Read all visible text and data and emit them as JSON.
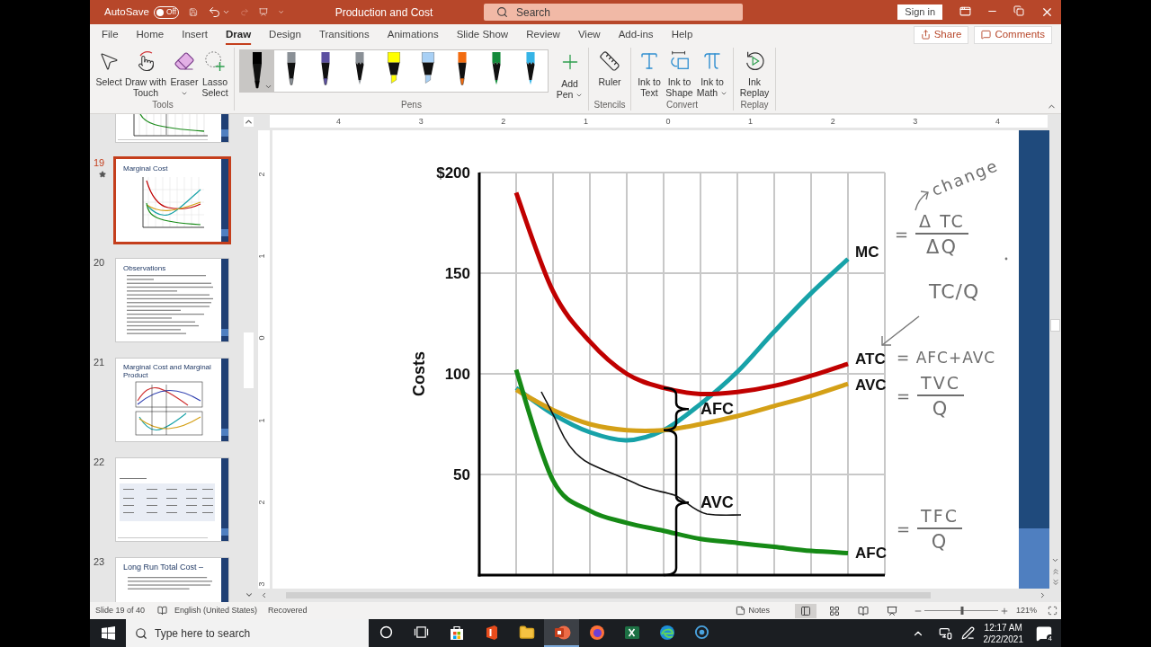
{
  "title_bar": {
    "autosave": {
      "label": "AutoSave",
      "state": "Off",
      "on": false
    },
    "quick_access": [
      {
        "kind": "save",
        "disabled": false
      },
      {
        "kind": "undo",
        "disabled": false
      },
      {
        "kind": "redo",
        "disabled": true
      },
      {
        "kind": "present",
        "disabled": false
      }
    ],
    "title": "Production and Cost",
    "search": {
      "placeholder": "Search"
    },
    "sign_in": "Sign in"
  },
  "tabs": [
    {
      "label": "File",
      "selected": false
    },
    {
      "label": "Home",
      "selected": false
    },
    {
      "label": "Insert",
      "selected": false
    },
    {
      "label": "Draw",
      "selected": true
    },
    {
      "label": "Design",
      "selected": false
    },
    {
      "label": "Transitions",
      "selected": false
    },
    {
      "label": "Animations",
      "selected": false
    },
    {
      "label": "Slide Show",
      "selected": false
    },
    {
      "label": "Review",
      "selected": false
    },
    {
      "label": "View",
      "selected": false
    },
    {
      "label": "Add-ins",
      "selected": false
    },
    {
      "label": "Help",
      "selected": false
    }
  ],
  "actions": [
    {
      "kind": "share",
      "label": "Share"
    },
    {
      "kind": "comments",
      "label": "Comments"
    }
  ],
  "ribbon": {
    "groups": [
      {
        "kind": "buttons",
        "label": "Tools",
        "items": [
          {
            "kind": "select",
            "label": "Select",
            "dropdown": false
          },
          {
            "kind": "touch",
            "label": "Draw with Touch",
            "dropdown": false
          },
          {
            "kind": "eraser",
            "label": "Eraser",
            "dropdown": true
          },
          {
            "kind": "lasso",
            "label": "Lasso Select",
            "dropdown": false
          }
        ]
      },
      {
        "kind": "gallery",
        "label": "Pens",
        "pens": [
          {
            "kind": "pen",
            "color": "#000000",
            "selected": true
          },
          {
            "kind": "pen",
            "color": "#8a9096",
            "selected": false
          },
          {
            "kind": "pen",
            "color": "#5b4fa0",
            "selected": false
          },
          {
            "kind": "pencil",
            "color": "#8a9096",
            "selected": false
          },
          {
            "kind": "highlighter",
            "color": "#ffff00",
            "selected": false
          },
          {
            "kind": "highlighter",
            "color": "#a8d0f5",
            "selected": false
          },
          {
            "kind": "pen",
            "color": "#f26b0f",
            "selected": false
          },
          {
            "kind": "pencil",
            "color": "#138a3a",
            "selected": false
          },
          {
            "kind": "pencil",
            "color": "#36b4e6",
            "selected": false
          }
        ],
        "items": [
          {
            "kind": "add-pen",
            "label": "Add Pen",
            "dropdown": true
          }
        ]
      },
      {
        "kind": "buttons",
        "label": "Stencils",
        "items": [
          {
            "kind": "ruler",
            "label": "Ruler",
            "dropdown": false
          }
        ]
      },
      {
        "kind": "buttons",
        "label": "Convert",
        "items": [
          {
            "kind": "ink-to-text",
            "label": "Ink to Text",
            "dropdown": false
          },
          {
            "kind": "ink-to-shape",
            "label": "Ink to Shape",
            "dropdown": false
          },
          {
            "kind": "ink-to-math",
            "label": "Ink to Math",
            "dropdown": true
          }
        ]
      },
      {
        "kind": "buttons",
        "label": "Replay",
        "items": [
          {
            "kind": "replay",
            "label": "Ink Replay",
            "dropdown": false
          }
        ]
      }
    ]
  },
  "slides_panel": {
    "thumbnails": [
      {
        "kind": "chart-bottom",
        "selected": false,
        "animated": false
      },
      {
        "number": "19",
        "title": "Marginal Cost",
        "kind": "chart",
        "selected": true,
        "animated": true
      },
      {
        "number": "20",
        "title": "Observations",
        "kind": "bullets",
        "selected": false,
        "animated": false
      },
      {
        "number": "21",
        "title": "Marginal Cost and Marginal Product",
        "kind": "two-charts",
        "selected": false,
        "animated": false
      },
      {
        "number": "22",
        "kind": "table",
        "selected": false,
        "animated": false
      },
      {
        "number": "23",
        "title": "Long Run Total Cost –",
        "kind": "text",
        "selected": false,
        "animated": false
      }
    ]
  },
  "rulers": {
    "horizontal": [
      "4",
      "3",
      "2",
      "1",
      "0",
      "1",
      "2",
      "3",
      "4"
    ],
    "vertical": [
      "2",
      "1",
      "0",
      "1",
      "2",
      "3"
    ]
  },
  "slide": {
    "chart_data": {
      "type": "line",
      "ylabel": "Costs",
      "categories": [
        null,
        null,
        null,
        null,
        null,
        null,
        null,
        null,
        null,
        null
      ],
      "ylim": [
        0,
        200
      ],
      "yticks": [
        {
          "value": 50,
          "label": "50"
        },
        {
          "value": 100,
          "label": "100"
        },
        {
          "value": 150,
          "label": "150"
        },
        {
          "value": 200,
          "label": "$200"
        }
      ],
      "grid": true,
      "series": [
        {
          "name": "MC",
          "color": "#17a2a8",
          "values": [
            93,
            80,
            71,
            67,
            72,
            85,
            101,
            121,
            140,
            157
          ]
        },
        {
          "name": "ATC",
          "color": "#c00000",
          "values": [
            190,
            141,
            116,
            100,
            93,
            90,
            91,
            94,
            99,
            105
          ]
        },
        {
          "name": "AVC",
          "color": "#d4a017",
          "values": [
            92,
            82,
            75,
            72,
            72,
            75,
            79,
            84,
            89,
            95
          ]
        },
        {
          "name": "AFC",
          "color": "#168a16",
          "values": [
            102,
            47,
            32,
            26,
            22,
            18,
            16,
            14,
            12,
            11
          ]
        }
      ],
      "annotations": [
        {
          "text": "AFC"
        },
        {
          "text": "AVC"
        }
      ]
    },
    "ink_notes": [
      {
        "kind": "word",
        "text": "change"
      },
      {
        "kind": "fraction",
        "prefix": "=",
        "numerator": "Δ TC",
        "denominator": "ΔQ"
      },
      {
        "kind": "word",
        "text": "TC/Q"
      },
      {
        "kind": "word",
        "text": "= AFC+AVC"
      },
      {
        "kind": "fraction",
        "prefix": "=",
        "numerator": "TVC",
        "denominator": "Q"
      },
      {
        "kind": "fraction",
        "prefix": "=",
        "numerator": "TFC",
        "denominator": "Q"
      }
    ]
  },
  "status_bar": {
    "slide": "Slide 19 of 40",
    "language": "English (United States)",
    "state": "Recovered",
    "notes": "Notes",
    "views": [
      {
        "kind": "normal",
        "selected": true
      },
      {
        "kind": "sorter",
        "selected": false
      },
      {
        "kind": "reading",
        "selected": false
      },
      {
        "kind": "slideshow",
        "selected": false
      }
    ],
    "zoom": {
      "label": "121%",
      "level": 0.51
    }
  },
  "taskbar": {
    "search": {
      "placeholder": "Type here to search"
    },
    "apps": [
      {
        "kind": "cortana",
        "selected": false
      },
      {
        "kind": "task-view",
        "selected": false
      },
      {
        "kind": "store",
        "selected": false
      },
      {
        "kind": "office",
        "selected": false
      },
      {
        "kind": "explorer",
        "selected": false
      },
      {
        "kind": "powerpoint",
        "selected": true
      },
      {
        "kind": "firefox",
        "selected": false
      },
      {
        "kind": "excel",
        "selected": false
      },
      {
        "kind": "edge",
        "selected": false
      },
      {
        "kind": "recorder",
        "selected": false
      }
    ],
    "time": "12:17 AM",
    "date": "2/22/2021",
    "notifications": "4"
  }
}
